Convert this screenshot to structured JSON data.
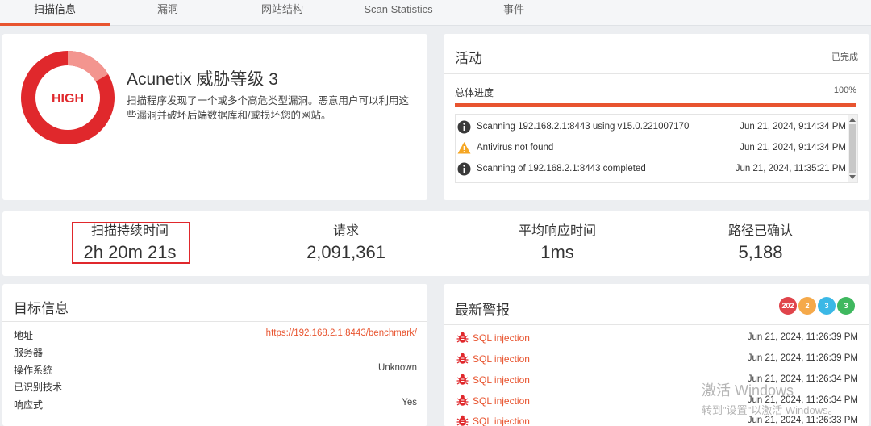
{
  "tabs": [
    {
      "label": "扫描信息",
      "active": true
    },
    {
      "label": "漏洞"
    },
    {
      "label": "网站结构"
    },
    {
      "label": "Scan Statistics"
    },
    {
      "label": "事件"
    }
  ],
  "threat": {
    "level_badge": "HIGH",
    "title": "Acunetix 威胁等级 3",
    "description": "扫描程序发现了一个或多个高危类型漏洞。恶意用户可以利用这些漏洞并破坏后端数据库和/或损坏您的网站。",
    "ring_color": "#e0282c",
    "ring_light_color": "#f3958f"
  },
  "activity": {
    "title": "活动",
    "status": "已完成",
    "progress_label": "总体进度",
    "progress_value": "100%",
    "progress_fraction": 1.0,
    "logs": [
      {
        "icon": "info-icon",
        "message": "Scanning 192.168.2.1:8443 using v15.0.221007170",
        "time": "Jun 21, 2024, 9:14:34 PM"
      },
      {
        "icon": "warning-icon",
        "message": "Antivirus not found",
        "time": "Jun 21, 2024, 9:14:34 PM"
      },
      {
        "icon": "info-icon",
        "message": "Scanning of 192.168.2.1:8443 completed",
        "time": "Jun 21, 2024, 11:35:21 PM"
      }
    ]
  },
  "stats": [
    {
      "label": "扫描持续时间",
      "value": "2h 20m 21s"
    },
    {
      "label": "请求",
      "value": "2,091,361"
    },
    {
      "label": "平均响应时间",
      "value": "1ms"
    },
    {
      "label": "路径已确认",
      "value": "5,188"
    }
  ],
  "target": {
    "title": "目标信息",
    "rows": [
      {
        "key": "地址",
        "value": "https://192.168.2.1:8443/benchmark/"
      },
      {
        "key": "服务器",
        "value": ""
      },
      {
        "key": "操作系统",
        "value": "Unknown"
      },
      {
        "key": "已识别技术",
        "value": ""
      },
      {
        "key": "响应式",
        "value": "Yes"
      }
    ]
  },
  "alerts": {
    "title": "最新警报",
    "badges": [
      {
        "count": "202",
        "color": "#e0444b"
      },
      {
        "count": "2",
        "color": "#f5a94a"
      },
      {
        "count": "3",
        "color": "#3bb8e6"
      },
      {
        "count": "3",
        "color": "#3fb85f"
      }
    ],
    "items": [
      {
        "name": "SQL injection",
        "time": "Jun 21, 2024, 11:26:39 PM"
      },
      {
        "name": "SQL injection",
        "time": "Jun 21, 2024, 11:26:39 PM"
      },
      {
        "name": "SQL injection",
        "time": "Jun 21, 2024, 11:26:34 PM"
      },
      {
        "name": "SQL injection",
        "time": "Jun 21, 2024, 11:26:34 PM"
      },
      {
        "name": "SQL injection",
        "time": "Jun 21, 2024, 11:26:33 PM"
      }
    ]
  },
  "watermark": {
    "line1": "激活 Windows",
    "line2": "转到\"设置\"以激活 Windows。"
  },
  "colors": {
    "accent": "#e8542f",
    "danger": "#e0282c"
  }
}
